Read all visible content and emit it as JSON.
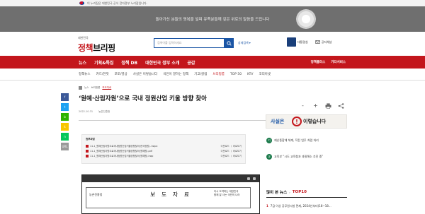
{
  "gov_banner": {
    "text": "이 누리집은 대한민국 공식 전자정부 누리집입니다."
  },
  "memorial": {
    "message": "돌아가신 분들의 명복을 빌며 유족분들께 깊은 위로의 말씀을 드립니다"
  },
  "logo": {
    "small": "대한민국",
    "main_red": "정책",
    "main_rest": "브리핑"
  },
  "search": {
    "placeholder": "검색어를 입력하세요",
    "detail_label": "상세검색"
  },
  "header_links": [
    {
      "label": "대통령실"
    },
    {
      "label": "공지채널"
    }
  ],
  "nav": {
    "items": [
      "뉴스",
      "기획&특집",
      "정책 DB",
      "대한민국 정부 소개",
      "공감"
    ],
    "right": [
      "정책플러스",
      "기타서비스"
    ]
  },
  "subnav": {
    "items": [
      "정책뉴스",
      "카드/한컷",
      "포토/영상",
      "사실은 이렇습니다",
      "국민이 말하는 정책",
      "기고/칼럼",
      "브리핑룸",
      "TOP 50",
      "KTV",
      "코리아넷"
    ],
    "active_index": 6
  },
  "share": [
    "f",
    "t",
    "b",
    "k",
    "n",
    "URL"
  ],
  "breadcrumb": {
    "items": [
      "뉴스",
      "브리핑룸",
      "보도자료"
    ]
  },
  "article": {
    "title": "‘원예·산림자원’으로 국내 정원산업 키울 방향 찾아",
    "date": "2022.10.31",
    "source": "농촌진흥청"
  },
  "tools": [
    "-",
    "+",
    "print-icon",
    "share-icon"
  ],
  "attachments": {
    "title": "첨부파일",
    "files": [
      {
        "name": "11-1_원예산림자원으로국내정원산업키울방향찾아(한국정원)..hwpx",
        "actions": "다운로드 ㅣ  바로보기"
      },
      {
        "name": "11-1_원예산림자원으로국내정원산업키울방향찾아(원예원).pdf",
        "actions": "다운로드 ㅣ  바로보기"
      },
      {
        "name": "11-1_원예산림자원으로국내정원산업키울방향찾아(원예원).hwp",
        "actions": "다운로드 ㅣ  바로보기"
      }
    ]
  },
  "document_preview": {
    "logo": "농촌진흥청",
    "title": "보 도 자 료",
    "slogan": "다시 도약하는 대한민국\n함께 잘 사는 국민의 나라"
  },
  "fact_banner": {
    "left": "사실은",
    "bang": "!",
    "right": "이렇습니다"
  },
  "fact_items": [
    {
      "badge": "기",
      "text": "재난종합체 체계, 작전 업무 처럼 처리"
    },
    {
      "badge": "교",
      "text": "교육부 “시도 교육청과 과밀해소 추진 중”"
    }
  ],
  "hot_news": {
    "title_a": "많이 본 뉴스",
    "title_b": "TOP10",
    "items": [
      {
        "rank": "1",
        "text": "7급 이상 공무원시험 면제, 2024년부터(18~18…"
      }
    ]
  },
  "colors": {
    "brand_red": "#c3161c",
    "brand_blue": "#1a55a5"
  }
}
